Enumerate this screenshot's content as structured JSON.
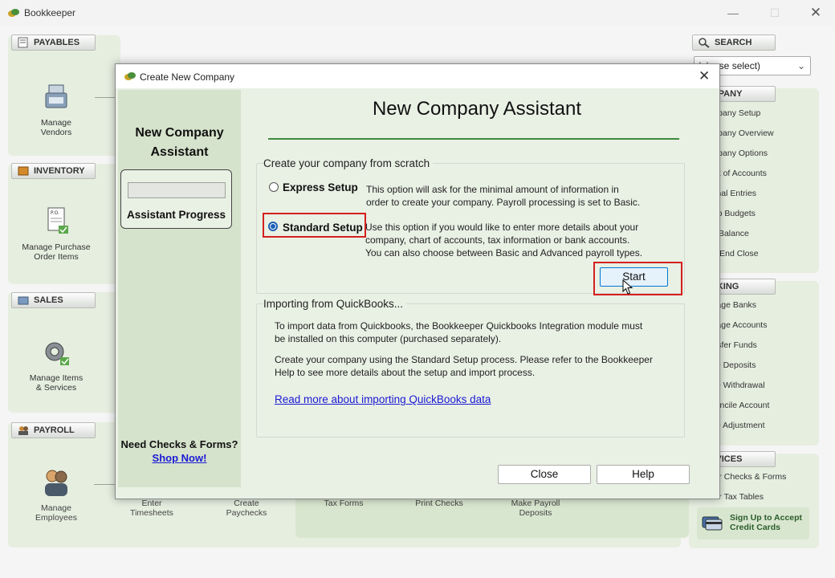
{
  "app": {
    "title": "Bookkeeper"
  },
  "left_panels": {
    "payables": {
      "tab": "PAYABLES",
      "item": "Manage\nVendors"
    },
    "inventory": {
      "tab": "INVENTORY",
      "item": "Manage Purchase\nOrder Items"
    },
    "sales": {
      "tab": "SALES",
      "item": "Manage Items\n& Services"
    },
    "payroll": {
      "tab": "PAYROLL",
      "items": [
        "Manage\nEmployees",
        "Enter\nTimesheets",
        "Create\nPaychecks",
        "Tax Forms",
        "Print Checks",
        "Make Payroll\nDeposits"
      ]
    }
  },
  "right_sidebar": {
    "search_tab": "SEARCH",
    "search_value": "(please select)",
    "company_tab": "COMPANY",
    "company_items": [
      "Company Setup",
      "Company Overview",
      "Company Options",
      "Chart of Accounts",
      "Journal Entries",
      "Setup Budgets",
      "Trial Balance",
      "Year End Close"
    ],
    "banking_tab": "BANKING",
    "banking_items": [
      "Manage Banks",
      "Manage Accounts",
      "Transfer Funds",
      "Make Deposits",
      "Make Withdrawal",
      "Reconcile Account",
      "Make Adjustment"
    ],
    "services_tab": "SERVICES",
    "services_items": [
      "Order Checks & Forms",
      "Order Tax Tables"
    ],
    "credit_cards": "Sign Up to Accept\nCredit Cards"
  },
  "dialog": {
    "title": "Create New Company",
    "left": {
      "title": "New Company\nAssistant",
      "progress_label": "Assistant Progress",
      "need_checks": "Need Checks & Forms?",
      "shop_now": "Shop Now!"
    },
    "heading": "New Company Assistant",
    "scratch": {
      "title": "Create your company from scratch",
      "express_label": "Express Setup",
      "express_desc": "This option will ask for the minimal amount of information in\norder to create your company. Payroll processing is set to Basic.",
      "standard_label": "Standard Setup",
      "standard_desc": "Use this option if you would like to enter more details about your\ncompany, chart of accounts, tax information or bank accounts.\nYou can also choose between Basic and Advanced payroll types.",
      "start_label": "Start"
    },
    "import": {
      "title": "Importing from QuickBooks...",
      "para1": "To import data from Quickbooks, the Bookkeeper Quickbooks Integration module must\nbe installed on this computer (purchased separately).",
      "para2": "Create your company using the Standard Setup process. Please refer to the Bookkeeper\nHelp to see more details about the setup and import process.",
      "link": "Read more about importing QuickBooks data"
    },
    "close_label": "Close",
    "help_label": "Help"
  }
}
